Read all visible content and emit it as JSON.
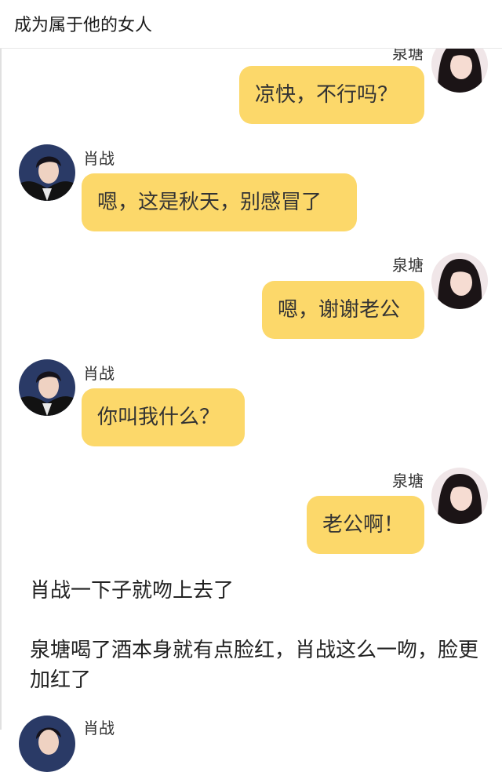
{
  "header": {
    "title": "成为属于他的女人"
  },
  "names": {
    "female": "泉塘",
    "male": "肖战"
  },
  "messages": [
    {
      "sender": "泉塘",
      "side": "right",
      "text": "凉快，不行吗？"
    },
    {
      "sender": "肖战",
      "side": "left",
      "text": "嗯，这是秋天，别感冒了"
    },
    {
      "sender": "泉塘",
      "side": "right",
      "text": "嗯，谢谢老公"
    },
    {
      "sender": "肖战",
      "side": "left",
      "text": "你叫我什么？"
    },
    {
      "sender": "泉塘",
      "side": "right",
      "text": "老公啊！"
    }
  ],
  "narration": [
    "肖战一下子就吻上去了",
    "泉塘喝了酒本身就有点脸红，肖战这么一吻，脸更加红了"
  ],
  "colors": {
    "bubble": "#fcd86a",
    "background": "#ffffff"
  }
}
